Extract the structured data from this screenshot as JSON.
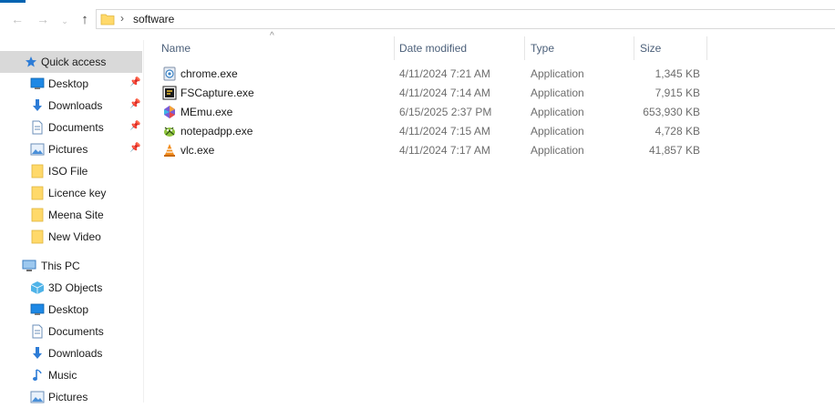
{
  "address": {
    "separator": "›",
    "current_folder": "software"
  },
  "sidebar": {
    "quick_access": {
      "label": "Quick access"
    },
    "pinned": [
      {
        "label": "Desktop",
        "icon": "desktop-icon",
        "pinned": true
      },
      {
        "label": "Downloads",
        "icon": "download-arrow-icon",
        "pinned": true
      },
      {
        "label": "Documents",
        "icon": "documents-icon",
        "pinned": true
      },
      {
        "label": "Pictures",
        "icon": "pictures-icon",
        "pinned": true
      },
      {
        "label": "ISO File",
        "icon": "folder-icon",
        "pinned": false
      },
      {
        "label": "Licence key",
        "icon": "folder-icon",
        "pinned": false
      },
      {
        "label": "Meena Site",
        "icon": "folder-icon",
        "pinned": false
      },
      {
        "label": "New Video",
        "icon": "folder-icon",
        "pinned": false
      }
    ],
    "this_pc": {
      "label": "This PC"
    },
    "pc_items": [
      {
        "label": "3D Objects",
        "icon": "3d-objects-icon"
      },
      {
        "label": "Desktop",
        "icon": "desktop-icon"
      },
      {
        "label": "Documents",
        "icon": "documents-icon"
      },
      {
        "label": "Downloads",
        "icon": "download-arrow-icon"
      },
      {
        "label": "Music",
        "icon": "music-note-icon"
      },
      {
        "label": "Pictures",
        "icon": "pictures-icon"
      }
    ]
  },
  "columns": {
    "name": "Name",
    "date": "Date modified",
    "type": "Type",
    "size": "Size"
  },
  "files": [
    {
      "name": "chrome.exe",
      "date": "4/11/2024 7:21 AM",
      "type": "Application",
      "size": "1,345 KB",
      "icon": "chrome-installer-icon"
    },
    {
      "name": "FSCapture.exe",
      "date": "4/11/2024 7:14 AM",
      "type": "Application",
      "size": "7,915 KB",
      "icon": "fscapture-icon"
    },
    {
      "name": "MEmu.exe",
      "date": "6/15/2025 2:37 PM",
      "type": "Application",
      "size": "653,930 KB",
      "icon": "memu-icon"
    },
    {
      "name": "notepadpp.exe",
      "date": "4/11/2024 7:15 AM",
      "type": "Application",
      "size": "4,728 KB",
      "icon": "notepadpp-icon"
    },
    {
      "name": "vlc.exe",
      "date": "4/11/2024 7:17 AM",
      "type": "Application",
      "size": "41,857 KB",
      "icon": "vlc-cone-icon"
    }
  ],
  "colors": {
    "accent": "#0063b1",
    "selected_bg": "#d9d9d9",
    "folder": "#ffd96a"
  }
}
